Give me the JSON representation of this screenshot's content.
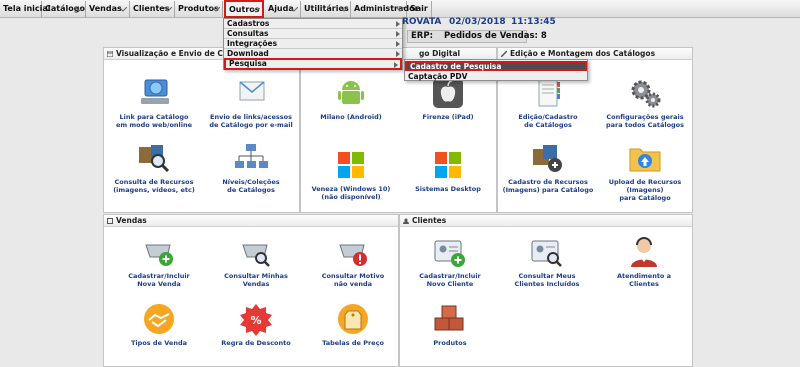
{
  "menu": {
    "items": [
      {
        "label": "Tela inicial"
      },
      {
        "label": "Catálogo"
      },
      {
        "label": "Vendas"
      },
      {
        "label": "Clientes"
      },
      {
        "label": "Produtos"
      },
      {
        "label": "Outros"
      },
      {
        "label": "Ajuda"
      },
      {
        "label": "Utilitários"
      },
      {
        "label": "Administrador"
      },
      {
        "label": "Sair"
      }
    ]
  },
  "dropdown": {
    "items": [
      {
        "label": "Cadastros"
      },
      {
        "label": "Consultas"
      },
      {
        "label": "Integrações"
      },
      {
        "label": "Download"
      },
      {
        "label": "Pesquisa"
      }
    ],
    "submenu": [
      {
        "label": "Cadastro de Pesquisa"
      },
      {
        "label": "Captação PDV"
      }
    ]
  },
  "header": {
    "company_fragment": "ROVATA",
    "date": "02/03/2018",
    "time": "11:13:45",
    "erp_label": "ERP:",
    "pedidos": "Pedidos de Vendas: 8"
  },
  "panels": {
    "visualizacao": {
      "title": "Visualização e Envio de Catálo",
      "tiles": [
        {
          "label_1": "Link para Catálogo",
          "label_2": "em modo web/online"
        },
        {
          "label_1": "Envio de links/acessos",
          "label_2": "de Catálogo por e-mail"
        },
        {
          "label_1": "Consulta de Recursos",
          "label_2": "(imagens, vídeos, etc)"
        },
        {
          "label_1": "Níveis/Coleções",
          "label_2": "de Catálogos"
        }
      ]
    },
    "digital": {
      "title": "go Digital",
      "tiles": [
        {
          "label_1": "Milano (Android)",
          "label_2": ""
        },
        {
          "label_1": "Firenze (iPad)",
          "label_2": ""
        },
        {
          "label_1": "Veneza (Windows 10)",
          "label_2": "(não disponível)"
        },
        {
          "label_1": "Sistemas Desktop",
          "label_2": ""
        }
      ]
    },
    "edicao": {
      "title": "Edição e Montagem dos Catálogos",
      "tiles": [
        {
          "label_1": "Edição/Cadastro",
          "label_2": "de Catálogos"
        },
        {
          "label_1": "Configurações gerais",
          "label_2": "para todos Catálogos"
        },
        {
          "label_1": "Cadastro de Recursos",
          "label_2": "(Imagens) para Catálogo"
        },
        {
          "label_1": "Upload de Recursos (Imagens)",
          "label_2": "para Catálogo"
        }
      ]
    },
    "vendas": {
      "title": "Vendas",
      "tiles": [
        {
          "label_1": "Cadastrar/Incluir",
          "label_2": "Nova Venda"
        },
        {
          "label_1": "Consultar Minhas",
          "label_2": "Vendas"
        },
        {
          "label_1": "Consultar Motivo",
          "label_2": "não venda"
        },
        {
          "label_1": "Tipos de Venda",
          "label_2": ""
        },
        {
          "label_1": "Regra de Desconto",
          "label_2": ""
        },
        {
          "label_1": "Tabelas de Preço",
          "label_2": ""
        }
      ]
    },
    "clientes": {
      "title": "Clientes",
      "tiles": [
        {
          "label_1": "Cadastrar/Incluir",
          "label_2": "Novo Cliente"
        },
        {
          "label_1": "Consultar Meus",
          "label_2": "Clientes Incluídos"
        },
        {
          "label_1": "Atendimento a",
          "label_2": "Clientes"
        },
        {
          "label_1": "Produtos",
          "label_2": ""
        }
      ]
    }
  },
  "colors": {
    "link_blue": "#1c3d8c",
    "highlight_red": "#d31a1a",
    "submenu_selected": "#4d4d4d"
  }
}
